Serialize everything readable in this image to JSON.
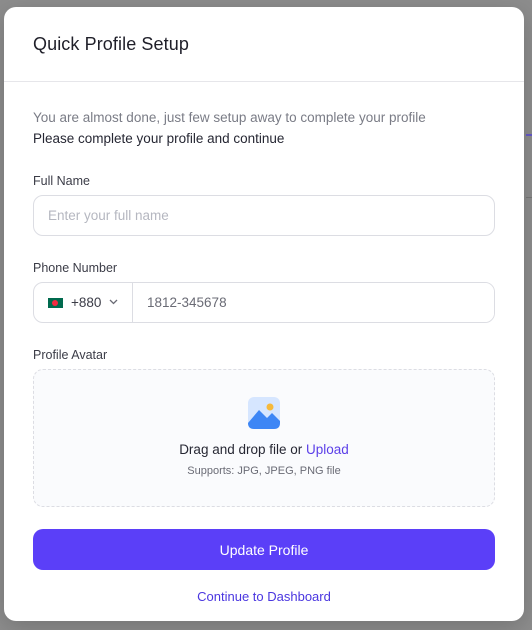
{
  "modal": {
    "title": "Quick Profile Setup",
    "intro_text": "You are almost done, just few setup away to complete your profile",
    "intro_strong": "Please complete your profile and continue"
  },
  "full_name": {
    "label": "Full Name",
    "placeholder": "Enter your full name",
    "value": ""
  },
  "phone": {
    "label": "Phone Number",
    "country_code": "+880",
    "flag_icon": "bangladesh-flag-icon",
    "placeholder": "1812-345678",
    "value": ""
  },
  "avatar": {
    "label": "Profile Avatar",
    "drag_text": "Drag and drop file or ",
    "upload_link": "Upload",
    "supports": "Supports: JPG, JPEG, PNG file",
    "icon": "image-icon"
  },
  "actions": {
    "update_label": "Update Profile",
    "dashboard_label": "Continue to Dashboard"
  },
  "colors": {
    "accent": "#5b3ff8",
    "link": "#4a36e0",
    "overlay": "#8d8d8d"
  }
}
